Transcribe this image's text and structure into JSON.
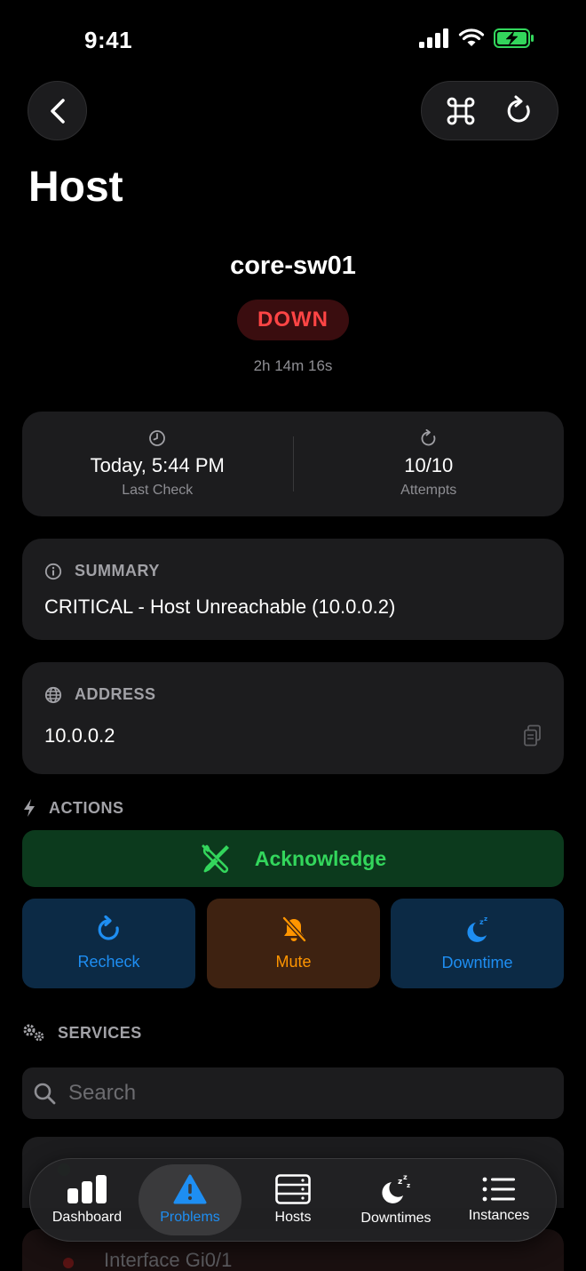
{
  "status_bar": {
    "time": "9:41"
  },
  "page": {
    "title": "Host"
  },
  "host": {
    "name": "core-sw01",
    "state": "DOWN",
    "duration": "2h 14m 16s"
  },
  "stats": {
    "last_check": {
      "value": "Today, 5:44 PM",
      "label": "Last Check"
    },
    "attempts": {
      "value": "10/10",
      "label": "Attempts"
    }
  },
  "summary": {
    "header": "SUMMARY",
    "text": "CRITICAL - Host Unreachable (10.0.0.2)"
  },
  "address": {
    "header": "ADDRESS",
    "value": "10.0.0.2"
  },
  "actions": {
    "header": "ACTIONS",
    "acknowledge": "Acknowledge",
    "recheck": "Recheck",
    "mute": "Mute",
    "downtime": "Downtime"
  },
  "services": {
    "header": "SERVICES",
    "search_placeholder": "Search",
    "second_row_name": "Interface Gi0/1"
  },
  "tabs": [
    {
      "label": "Dashboard",
      "icon": "chart-bar-icon"
    },
    {
      "label": "Problems",
      "icon": "warning-icon"
    },
    {
      "label": "Hosts",
      "icon": "server-icon"
    },
    {
      "label": "Downtimes",
      "icon": "moon-zzz-icon"
    },
    {
      "label": "Instances",
      "icon": "list-icon"
    }
  ],
  "colors": {
    "accent": "#1e8ef2",
    "down": "#ff4545",
    "acknowledge": "#33d65c",
    "mute": "#ff9500"
  }
}
